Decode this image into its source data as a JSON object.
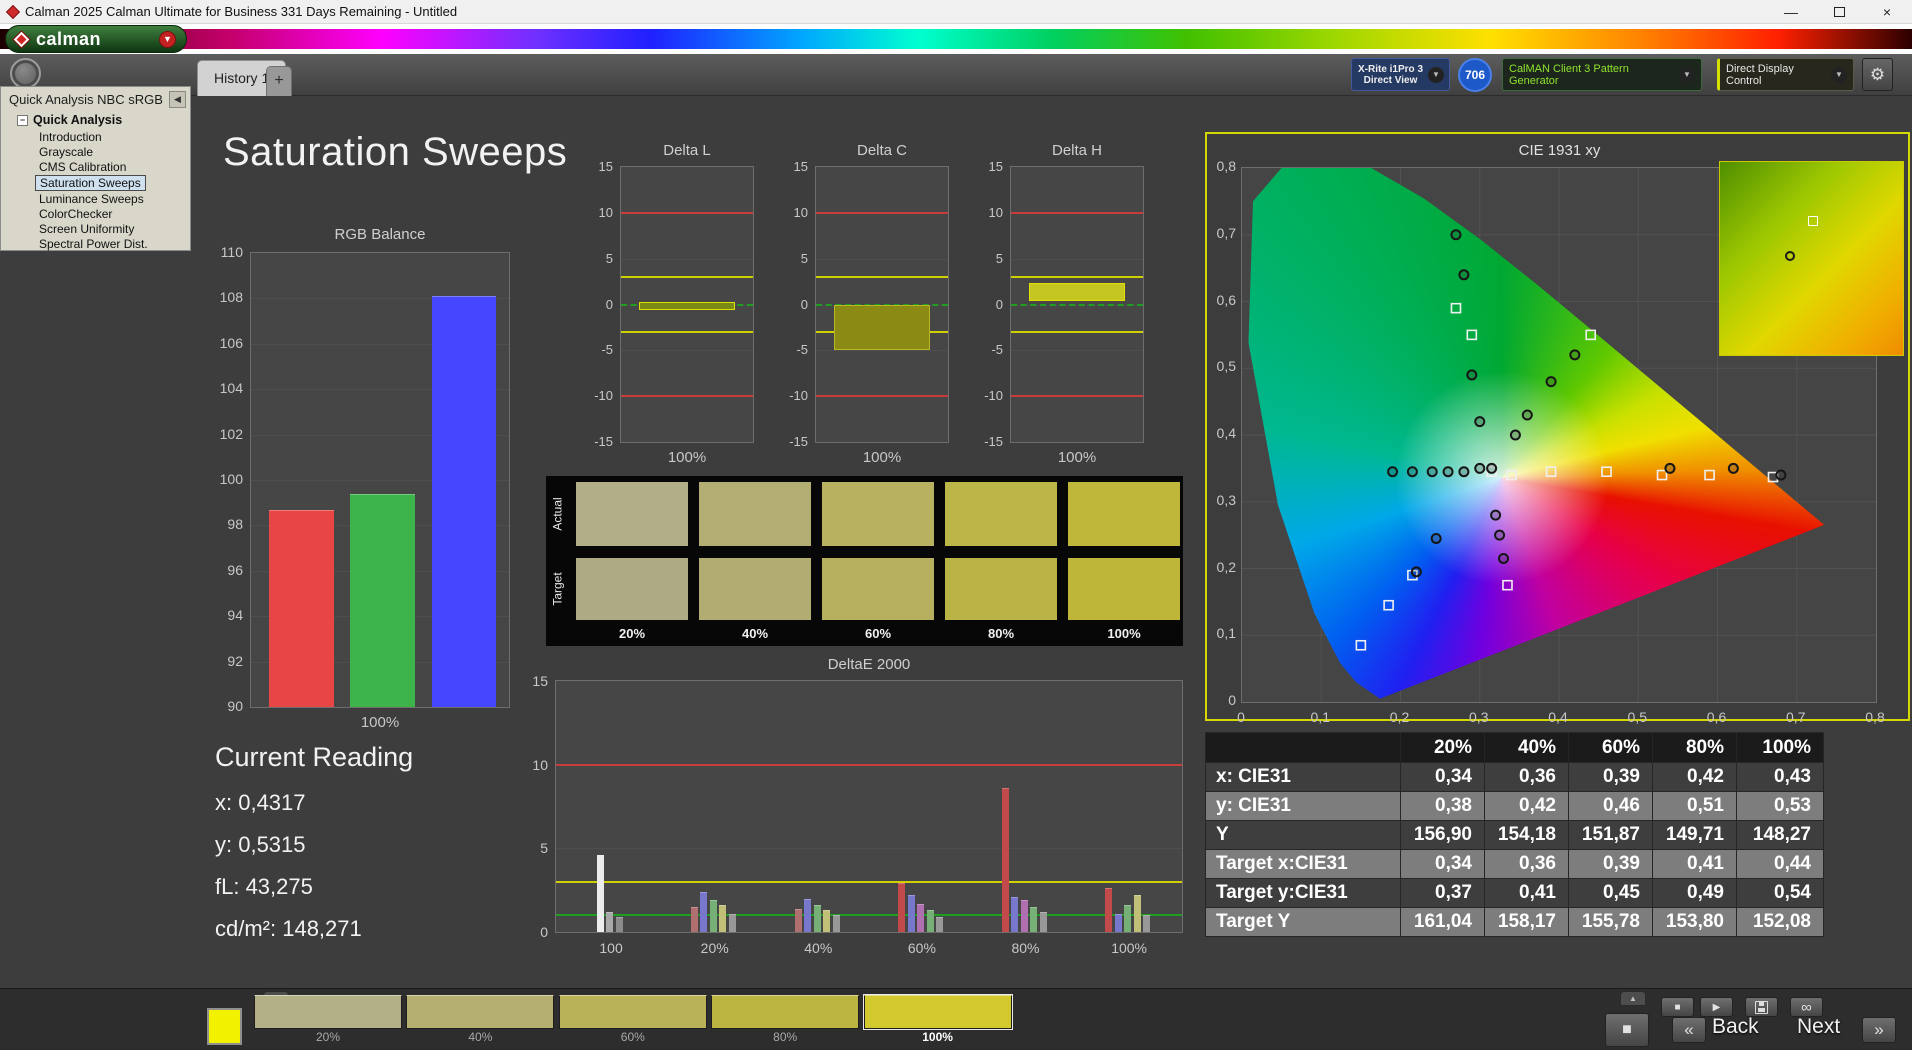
{
  "icons": {
    "minimize": "—",
    "close": "×",
    "dropdown": "▼",
    "collapse_left": "◀",
    "add_tab": "+",
    "tree_collapse": "−",
    "eject": "▲",
    "stop": "■",
    "play": "▶",
    "link": "∞",
    "gear": "⚙",
    "frame": "■",
    "back_chevrons": "«",
    "next_chevrons": "»"
  },
  "titlebar": {
    "title": "Calman 2025 Calman Ultimate for Business 331 Days Remaining  - Untitled"
  },
  "brand": {
    "logo_text": "calman",
    "logo_arrow": "▼"
  },
  "toolbar": {
    "tab_history": "History 1",
    "meter_line1": "X-Rite i1Pro 3",
    "meter_line2": "Direct View",
    "badge": "706",
    "pattern_generator": "CalMAN Client 3 Pattern Generator",
    "display_control": "Direct Display Control"
  },
  "sidebar": {
    "title": "Quick Analysis NBC sRGB",
    "root": "Quick Analysis",
    "items": [
      "Introduction",
      "Grayscale",
      "CMS Calibration",
      "Saturation Sweeps",
      "Luminance Sweeps",
      "ColorChecker",
      "Screen Uniformity",
      "Spectral Power Dist."
    ],
    "selected": "Saturation Sweeps"
  },
  "page": {
    "title": "Saturation Sweeps"
  },
  "current_reading": {
    "title": "Current Reading",
    "x": "x: 0,4317",
    "y": "y: 0,5315",
    "fl": "fL: 43,275",
    "cdm2": "cd/m²: 148,271"
  },
  "swatch_panel": {
    "row_labels": [
      "Actual",
      "Target"
    ],
    "col_labels": [
      "20%",
      "40%",
      "60%",
      "80%",
      "100%"
    ],
    "actual_colors": [
      "#b2ae87",
      "#b3ae74",
      "#b7b160",
      "#bcb548",
      "#beb73a"
    ],
    "target_colors": [
      "#aeaa84",
      "#b1ac72",
      "#b5af5e",
      "#bab346",
      "#bdb638"
    ]
  },
  "table": {
    "header": [
      "",
      "20%",
      "40%",
      "60%",
      "80%",
      "100%"
    ],
    "rows": [
      {
        "label": "x: CIE31",
        "values": [
          "0,34",
          "0,36",
          "0,39",
          "0,42",
          "0,43"
        ]
      },
      {
        "label": "y: CIE31",
        "values": [
          "0,38",
          "0,42",
          "0,46",
          "0,51",
          "0,53"
        ]
      },
      {
        "label": "Y",
        "values": [
          "156,90",
          "154,18",
          "151,87",
          "149,71",
          "148,27"
        ]
      },
      {
        "label": "Target x:CIE31",
        "values": [
          "0,34",
          "0,36",
          "0,39",
          "0,41",
          "0,44"
        ]
      },
      {
        "label": "Target y:CIE31",
        "values": [
          "0,37",
          "0,41",
          "0,45",
          "0,49",
          "0,54"
        ]
      },
      {
        "label": "Target Y",
        "values": [
          "161,04",
          "158,17",
          "155,78",
          "153,80",
          "152,08"
        ]
      }
    ]
  },
  "bottombar": {
    "swatches": [
      {
        "label": "20%",
        "color": "#b3af86",
        "selected": false
      },
      {
        "label": "40%",
        "color": "#b5b06f",
        "selected": false
      },
      {
        "label": "60%",
        "color": "#b9b259",
        "selected": false
      },
      {
        "label": "80%",
        "color": "#bdb542",
        "selected": false
      },
      {
        "label": "100%",
        "color": "#d2c92f",
        "selected": true
      }
    ],
    "back": "Back",
    "next": "Next"
  },
  "chart_data": [
    {
      "id": "rgb_balance",
      "type": "bar",
      "title": "RGB Balance",
      "xlabel": "100%",
      "categories": [
        "Red",
        "Green",
        "Blue"
      ],
      "values": [
        98.7,
        99.4,
        108.1
      ],
      "colors": [
        "#e84545",
        "#3cb44a",
        "#4646ff"
      ],
      "ylim": [
        90,
        110
      ],
      "ytick_step": 2,
      "grid": true
    },
    {
      "id": "delta_l",
      "type": "bar",
      "title": "Delta L",
      "xlabel": "100%",
      "ylim": [
        -15,
        15
      ],
      "ytick_step": 5,
      "ref_lines": [
        {
          "y": 10,
          "color": "#c83c3c"
        },
        {
          "y": -10,
          "color": "#c83c3c"
        },
        {
          "y": 3,
          "color": "#d0d000"
        },
        {
          "y": -3,
          "color": "#d0d000"
        },
        {
          "y": 0,
          "color": "#1f9e1f",
          "dashed": true
        }
      ],
      "bars": [
        {
          "from": -0.6,
          "to": 0.3,
          "fill": "#7a8a14",
          "stroke": "#dede00"
        }
      ]
    },
    {
      "id": "delta_c",
      "type": "bar",
      "title": "Delta C",
      "xlabel": "100%",
      "ylim": [
        -15,
        15
      ],
      "ytick_step": 5,
      "ref_lines": [
        {
          "y": 10,
          "color": "#c83c3c"
        },
        {
          "y": -10,
          "color": "#c83c3c"
        },
        {
          "y": 3,
          "color": "#d0d000"
        },
        {
          "y": -3,
          "color": "#d0d000"
        },
        {
          "y": 0,
          "color": "#1f9e1f",
          "dashed": true
        }
      ],
      "bars": [
        {
          "from": -5.0,
          "to": 0,
          "fill": "#8a8a14",
          "stroke": "#b8b820"
        }
      ]
    },
    {
      "id": "delta_h",
      "type": "bar",
      "title": "Delta H",
      "xlabel": "100%",
      "ylim": [
        -15,
        15
      ],
      "ytick_step": 5,
      "ref_lines": [
        {
          "y": 10,
          "color": "#c83c3c"
        },
        {
          "y": -10,
          "color": "#c83c3c"
        },
        {
          "y": 3,
          "color": "#d0d000"
        },
        {
          "y": -3,
          "color": "#d0d000"
        },
        {
          "y": 0,
          "color": "#1f9e1f",
          "dashed": true
        }
      ],
      "bars": [
        {
          "from": 0.4,
          "to": 2.3,
          "fill": "#c6c622",
          "stroke": "#e0e000"
        }
      ]
    },
    {
      "id": "deltae_2000",
      "type": "bar",
      "title": "DeltaE 2000",
      "ylim": [
        0,
        15
      ],
      "yticks": [
        0,
        5,
        10,
        15
      ],
      "group_labels": [
        "100",
        "20%",
        "40%",
        "60%",
        "80%",
        "100%"
      ],
      "ref_lines": [
        {
          "y": 10,
          "color": "#c83c3c"
        },
        {
          "y": 3,
          "color": "#d0d000"
        },
        {
          "y": 1,
          "color": "#1f9e1f"
        }
      ],
      "groups": [
        [
          {
            "c": "#ececec",
            "v": 4.6
          },
          {
            "c": "#a8a8a8",
            "v": 1.2
          },
          {
            "c": "#8b8b8b",
            "v": 0.9
          }
        ],
        [
          {
            "c": "#b07070",
            "v": 1.5
          },
          {
            "c": "#7777cc",
            "v": 2.4
          },
          {
            "c": "#77b077",
            "v": 1.9
          },
          {
            "c": "#c0c078",
            "v": 1.6
          },
          {
            "c": "#989898",
            "v": 1.1
          }
        ],
        [
          {
            "c": "#b07070",
            "v": 1.4
          },
          {
            "c": "#7777cc",
            "v": 2.0
          },
          {
            "c": "#77b077",
            "v": 1.6
          },
          {
            "c": "#c0c078",
            "v": 1.3
          },
          {
            "c": "#989898",
            "v": 1.0
          }
        ],
        [
          {
            "c": "#c24a4a",
            "v": 2.9
          },
          {
            "c": "#7777cc",
            "v": 2.2
          },
          {
            "c": "#b070b0",
            "v": 1.7
          },
          {
            "c": "#77b077",
            "v": 1.3
          },
          {
            "c": "#989898",
            "v": 0.9
          }
        ],
        [
          {
            "c": "#c24a4a",
            "v": 8.6
          },
          {
            "c": "#7777cc",
            "v": 2.1
          },
          {
            "c": "#b070b0",
            "v": 1.9
          },
          {
            "c": "#77b077",
            "v": 1.5
          },
          {
            "c": "#989898",
            "v": 1.2
          }
        ],
        [
          {
            "c": "#c24a4a",
            "v": 2.6
          },
          {
            "c": "#7777cc",
            "v": 1.1
          },
          {
            "c": "#77b077",
            "v": 1.6
          },
          {
            "c": "#c0c078",
            "v": 2.2
          },
          {
            "c": "#989898",
            "v": 1.0
          }
        ]
      ]
    },
    {
      "id": "cie_1931",
      "type": "scatter",
      "title": "CIE 1931 xy",
      "xlim": [
        0,
        0.8
      ],
      "ylim": [
        0,
        0.8
      ],
      "xticks": [
        "0",
        "0,1",
        "0,2",
        "0,3",
        "0,4",
        "0,5",
        "0,6",
        "0,7",
        "0,8"
      ],
      "yticks": [
        "0",
        "0,1",
        "0,2",
        "0,3",
        "0,4",
        "0,5",
        "0,6",
        "0,7",
        "0,8"
      ],
      "measured": [
        [
          0.27,
          0.7
        ],
        [
          0.28,
          0.64
        ],
        [
          0.29,
          0.49
        ],
        [
          0.3,
          0.42
        ],
        [
          0.36,
          0.43
        ],
        [
          0.39,
          0.48
        ],
        [
          0.42,
          0.52
        ],
        [
          0.19,
          0.345
        ],
        [
          0.215,
          0.345
        ],
        [
          0.24,
          0.345
        ],
        [
          0.26,
          0.345
        ],
        [
          0.28,
          0.345
        ],
        [
          0.3,
          0.35
        ],
        [
          0.315,
          0.35
        ],
        [
          0.54,
          0.35
        ],
        [
          0.62,
          0.35
        ],
        [
          0.68,
          0.34
        ],
        [
          0.245,
          0.245
        ],
        [
          0.22,
          0.195
        ],
        [
          0.32,
          0.28
        ],
        [
          0.325,
          0.25
        ],
        [
          0.33,
          0.215
        ],
        [
          0.345,
          0.4
        ]
      ],
      "targets": [
        [
          0.27,
          0.59
        ],
        [
          0.29,
          0.55
        ],
        [
          0.44,
          0.55
        ],
        [
          0.315,
          0.345
        ],
        [
          0.39,
          0.345
        ],
        [
          0.46,
          0.345
        ],
        [
          0.53,
          0.34
        ],
        [
          0.59,
          0.34
        ],
        [
          0.67,
          0.337
        ],
        [
          0.215,
          0.19
        ],
        [
          0.185,
          0.145
        ],
        [
          0.15,
          0.085
        ],
        [
          0.335,
          0.175
        ],
        [
          0.34,
          0.34
        ]
      ],
      "inset": {
        "square_pct": [
          50,
          30
        ],
        "circle_pct": [
          38,
          48
        ]
      }
    }
  ]
}
